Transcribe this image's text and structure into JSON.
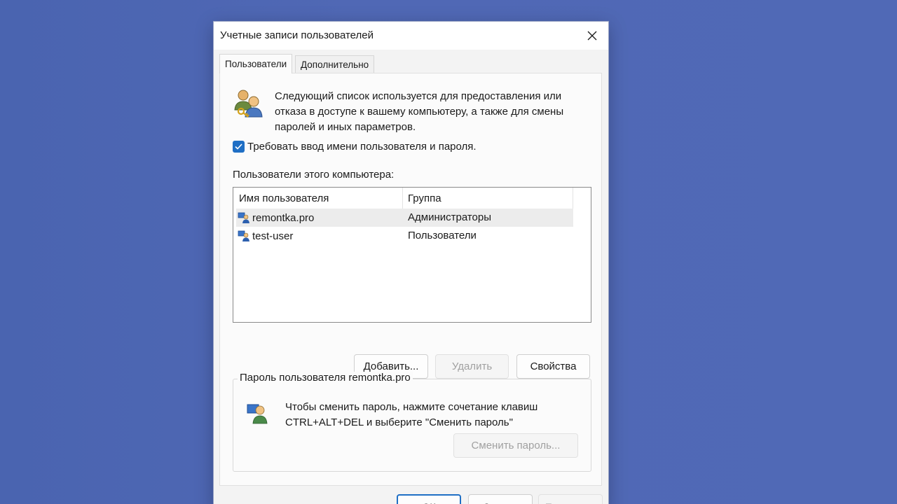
{
  "window": {
    "title": "Учетные записи пользователей"
  },
  "tabs": [
    {
      "label": "Пользователи",
      "active": true
    },
    {
      "label": "Дополнительно",
      "active": false
    }
  ],
  "intro": {
    "text": "Следующий список используется для предоставления или отказа в доступе к вашему компьютеру, а также для смены паролей и иных параметров.",
    "icon": "users-key-icon"
  },
  "require_login": {
    "label": "Требовать ввод имени пользователя и пароля.",
    "checked": true
  },
  "users_section": {
    "label": "Пользователи этого компьютера:",
    "columns": [
      "Имя пользователя",
      "Группа"
    ],
    "rows": [
      {
        "name": "remontka.pro",
        "group": "Администраторы",
        "selected": true
      },
      {
        "name": "test-user",
        "group": "Пользователи",
        "selected": false
      }
    ]
  },
  "list_buttons": {
    "add": "Добавить...",
    "remove": "Удалить",
    "properties": "Свойства"
  },
  "password_group": {
    "title": "Пароль пользователя remontka.pro",
    "text": "Чтобы сменить пароль, нажмите сочетание клавиш CTRL+ALT+DEL и выберите \"Сменить пароль\"",
    "change_button": "Сменить пароль..."
  },
  "footer": {
    "ok": "ОК",
    "cancel": "Отмена",
    "apply": "Применить"
  },
  "colors": {
    "desktop": "#4f69b6",
    "accent": "#1f6fc5"
  }
}
